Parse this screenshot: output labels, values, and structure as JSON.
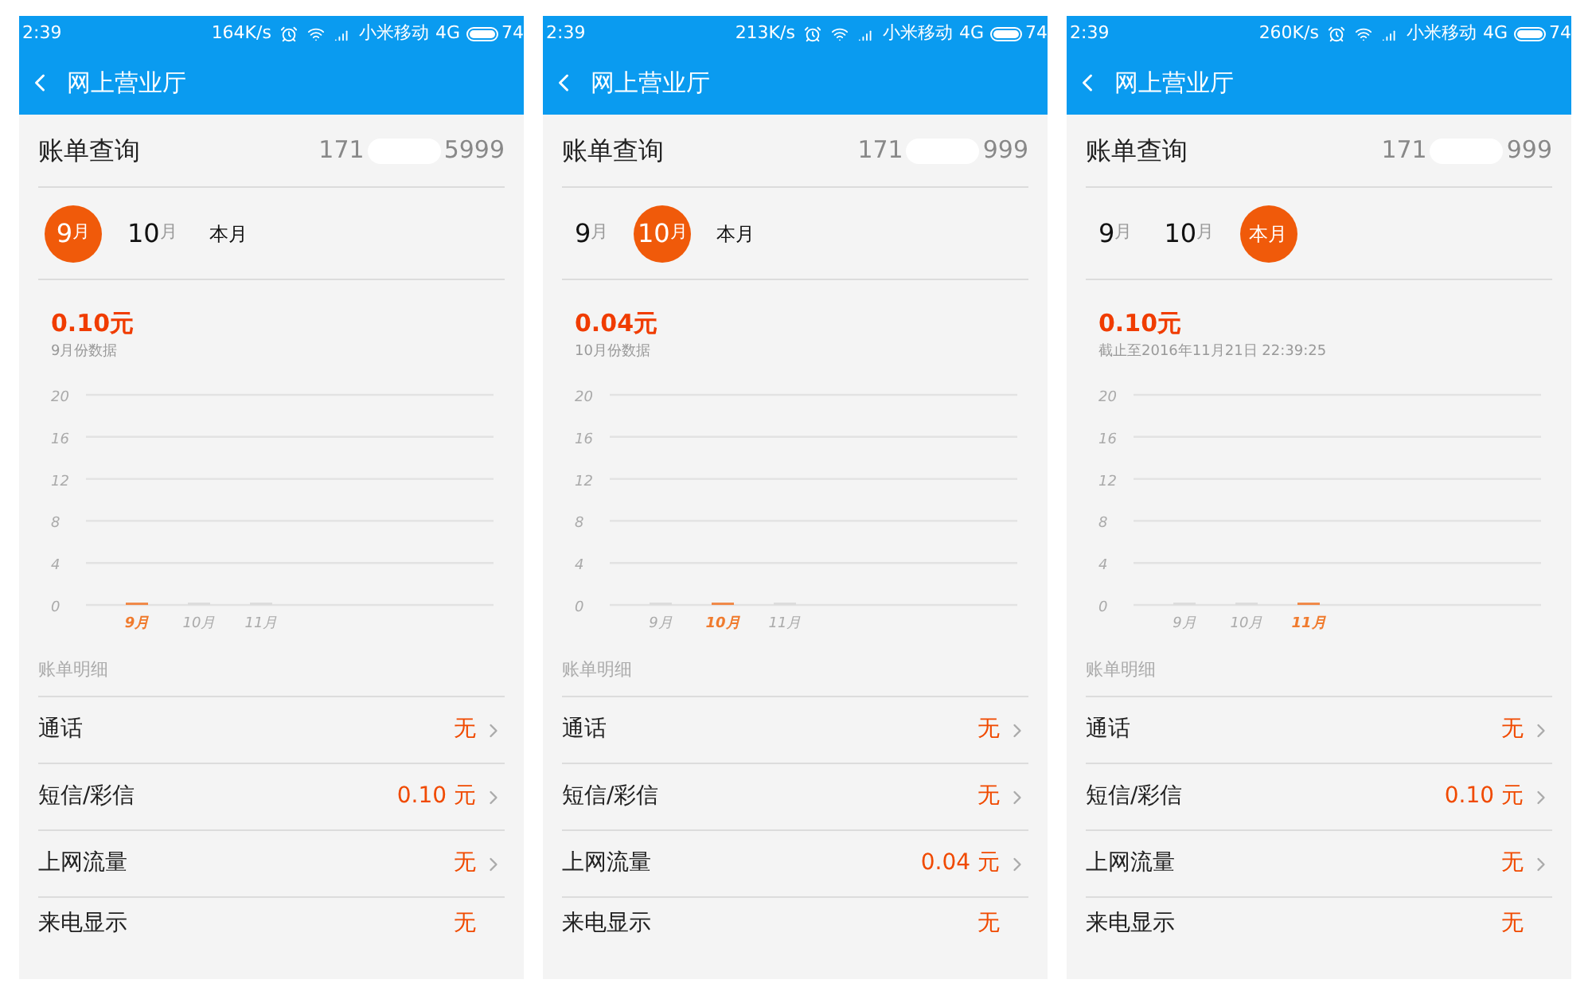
{
  "phones": [
    {
      "status_bar": {
        "time": "2:39",
        "speed": "164K/s",
        "carrier": "小米移动",
        "network": "4G",
        "battery": "74"
      },
      "app_bar": {
        "title": "网上营业厅"
      },
      "account": {
        "title": "账单查询",
        "number_start": "171",
        "number_end": "5999"
      },
      "month_tabs": [
        {
          "main": "9",
          "unit": "月",
          "selected": true
        },
        {
          "main": "10",
          "unit": "月",
          "selected": false
        },
        {
          "main": "本月",
          "selected": false
        }
      ],
      "amount": {
        "value": "0.10元",
        "note": "9月份数据"
      },
      "chart_data": {
        "type": "bar",
        "categories": [
          "9月",
          "10月",
          "11月"
        ],
        "values": [
          0,
          0,
          0
        ],
        "ylim": [
          0,
          20
        ],
        "yticks": [
          0,
          4,
          8,
          12,
          16,
          20
        ],
        "grid": true
      },
      "details_heading": "账单明细",
      "details": [
        {
          "label": "通话",
          "value": "无",
          "has_arrow": true
        },
        {
          "label": "短信/彩信",
          "value": "0.10 元",
          "has_arrow": true
        },
        {
          "label": "上网流量",
          "value": "无",
          "has_arrow": true
        },
        {
          "label": "来电显示",
          "value": "无",
          "has_arrow": false
        }
      ]
    },
    {
      "status_bar": {
        "time": "2:39",
        "speed": "213K/s",
        "carrier": "小米移动",
        "network": "4G",
        "battery": "74"
      },
      "app_bar": {
        "title": "网上营业厅"
      },
      "account": {
        "title": "账单查询",
        "number_start": "171",
        "number_end": "999"
      },
      "month_tabs": [
        {
          "main": "9",
          "unit": "月",
          "selected": false
        },
        {
          "main": "10",
          "unit": "月",
          "selected": true
        },
        {
          "main": "本月",
          "selected": false
        }
      ],
      "amount": {
        "value": "0.04元",
        "note": "10月份数据"
      },
      "chart_data": {
        "type": "bar",
        "categories": [
          "9月",
          "10月",
          "11月"
        ],
        "values": [
          0,
          0,
          0
        ],
        "ylim": [
          0,
          20
        ],
        "yticks": [
          0,
          4,
          8,
          12,
          16,
          20
        ],
        "grid": true
      },
      "details_heading": "账单明细",
      "details": [
        {
          "label": "通话",
          "value": "无",
          "has_arrow": true
        },
        {
          "label": "短信/彩信",
          "value": "无",
          "has_arrow": true
        },
        {
          "label": "上网流量",
          "value": "0.04 元",
          "has_arrow": true
        },
        {
          "label": "来电显示",
          "value": "无",
          "has_arrow": false
        }
      ]
    },
    {
      "status_bar": {
        "time": "2:39",
        "speed": "260K/s",
        "carrier": "小米移动",
        "network": "4G",
        "battery": "74"
      },
      "app_bar": {
        "title": "网上营业厅"
      },
      "account": {
        "title": "账单查询",
        "number_start": "171",
        "number_end": "999"
      },
      "month_tabs": [
        {
          "main": "9",
          "unit": "月",
          "selected": false
        },
        {
          "main": "10",
          "unit": "月",
          "selected": false
        },
        {
          "main": "本月",
          "selected": true
        }
      ],
      "amount": {
        "value": "0.10元",
        "note": "截止至2016年11月21日 22:39:25"
      },
      "chart_data": {
        "type": "bar",
        "categories": [
          "9月",
          "10月",
          "11月"
        ],
        "values": [
          0,
          0,
          0
        ],
        "ylim": [
          0,
          20
        ],
        "yticks": [
          0,
          4,
          8,
          12,
          16,
          20
        ],
        "grid": true
      },
      "details_heading": "账单明细",
      "details": [
        {
          "label": "通话",
          "value": "无",
          "has_arrow": true
        },
        {
          "label": "短信/彩信",
          "value": "0.10 元",
          "has_arrow": true
        },
        {
          "label": "上网流量",
          "value": "无",
          "has_arrow": true
        },
        {
          "label": "来电显示",
          "value": "无",
          "has_arrow": false
        }
      ]
    }
  ]
}
